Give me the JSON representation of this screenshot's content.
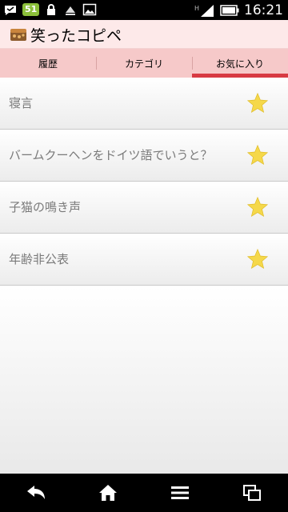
{
  "status_bar": {
    "notification_badge": "51",
    "network_label": "H",
    "time": "16:21"
  },
  "action_bar": {
    "title": "笑ったコピペ"
  },
  "tabs": [
    {
      "label": "履歴",
      "active": false
    },
    {
      "label": "カテゴリ",
      "active": false
    },
    {
      "label": "お気に入り",
      "active": true
    }
  ],
  "favorites": [
    {
      "title": "寝言",
      "starred": true
    },
    {
      "title": "バームクーヘンをドイツ語でいうと？",
      "starred": true
    },
    {
      "title": "子猫の鳴き声",
      "starred": true
    },
    {
      "title": "年齢非公表",
      "starred": true
    }
  ],
  "nav_bar": {
    "icons": [
      "back-icon",
      "home-icon",
      "menu-icon",
      "recent-apps-icon"
    ]
  },
  "colors": {
    "action_bar_bg": "#fde9e9",
    "tab_bar_bg": "#f6c9c9",
    "tab_indicator": "#d83a43",
    "star": "#f5d84a"
  }
}
